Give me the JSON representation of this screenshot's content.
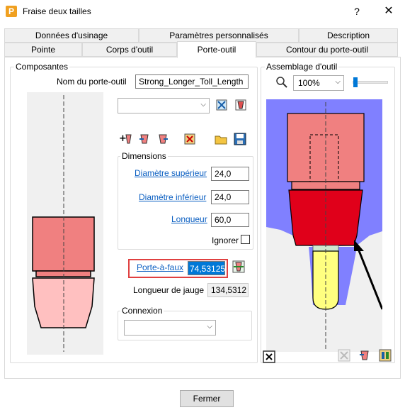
{
  "window": {
    "title": "Fraise deux tailles",
    "app_icon_letter": "P",
    "help_glyph": "?",
    "close_glyph": "✕"
  },
  "tabs_row1": [
    {
      "label": "Données d'usinage"
    },
    {
      "label": "Paramètres personnalisés"
    },
    {
      "label": "Description"
    }
  ],
  "tabs_row2": [
    {
      "label": "Pointe"
    },
    {
      "label": "Corps d'outil"
    },
    {
      "label": "Porte-outil",
      "active": true
    },
    {
      "label": "Contour du porte-outil"
    }
  ],
  "composantes": {
    "legend": "Composantes",
    "nom_label": "Nom du porte-outil",
    "nom_value": "Strong_Longer_Toll_Length",
    "component_select_value": "",
    "dimensions": {
      "legend": "Dimensions",
      "diametre_superieur_label": "Diamètre supérieur",
      "diametre_superieur_value": "24,0",
      "diametre_inferieur_label": "Diamètre inférieur",
      "diametre_inferieur_value": "24,0",
      "longueur_label": "Longueur",
      "longueur_value": "60,0",
      "ignorer_label": "Ignorer",
      "ignorer_checked": false
    },
    "porte_a_faux_label": "Porte-à-faux",
    "porte_a_faux_value": "74,53125",
    "longueur_jauge_label": "Longueur de jauge",
    "longueur_jauge_value": "134,5312",
    "connexion": {
      "legend": "Connexion",
      "value": ""
    }
  },
  "assemblage": {
    "legend": "Assemblage d'outil",
    "zoom_value": "100%",
    "slider_level": 0.0
  },
  "footer": {
    "fermer_label": "Fermer"
  },
  "colors": {
    "holder_top": "#f08080",
    "holder_bottom": "#ffc0c0",
    "assembly_holder": "#e0001a",
    "assembly_bg": "#8080ff",
    "tool_tip": "#ffff80",
    "highlight_border": "#e04040"
  }
}
